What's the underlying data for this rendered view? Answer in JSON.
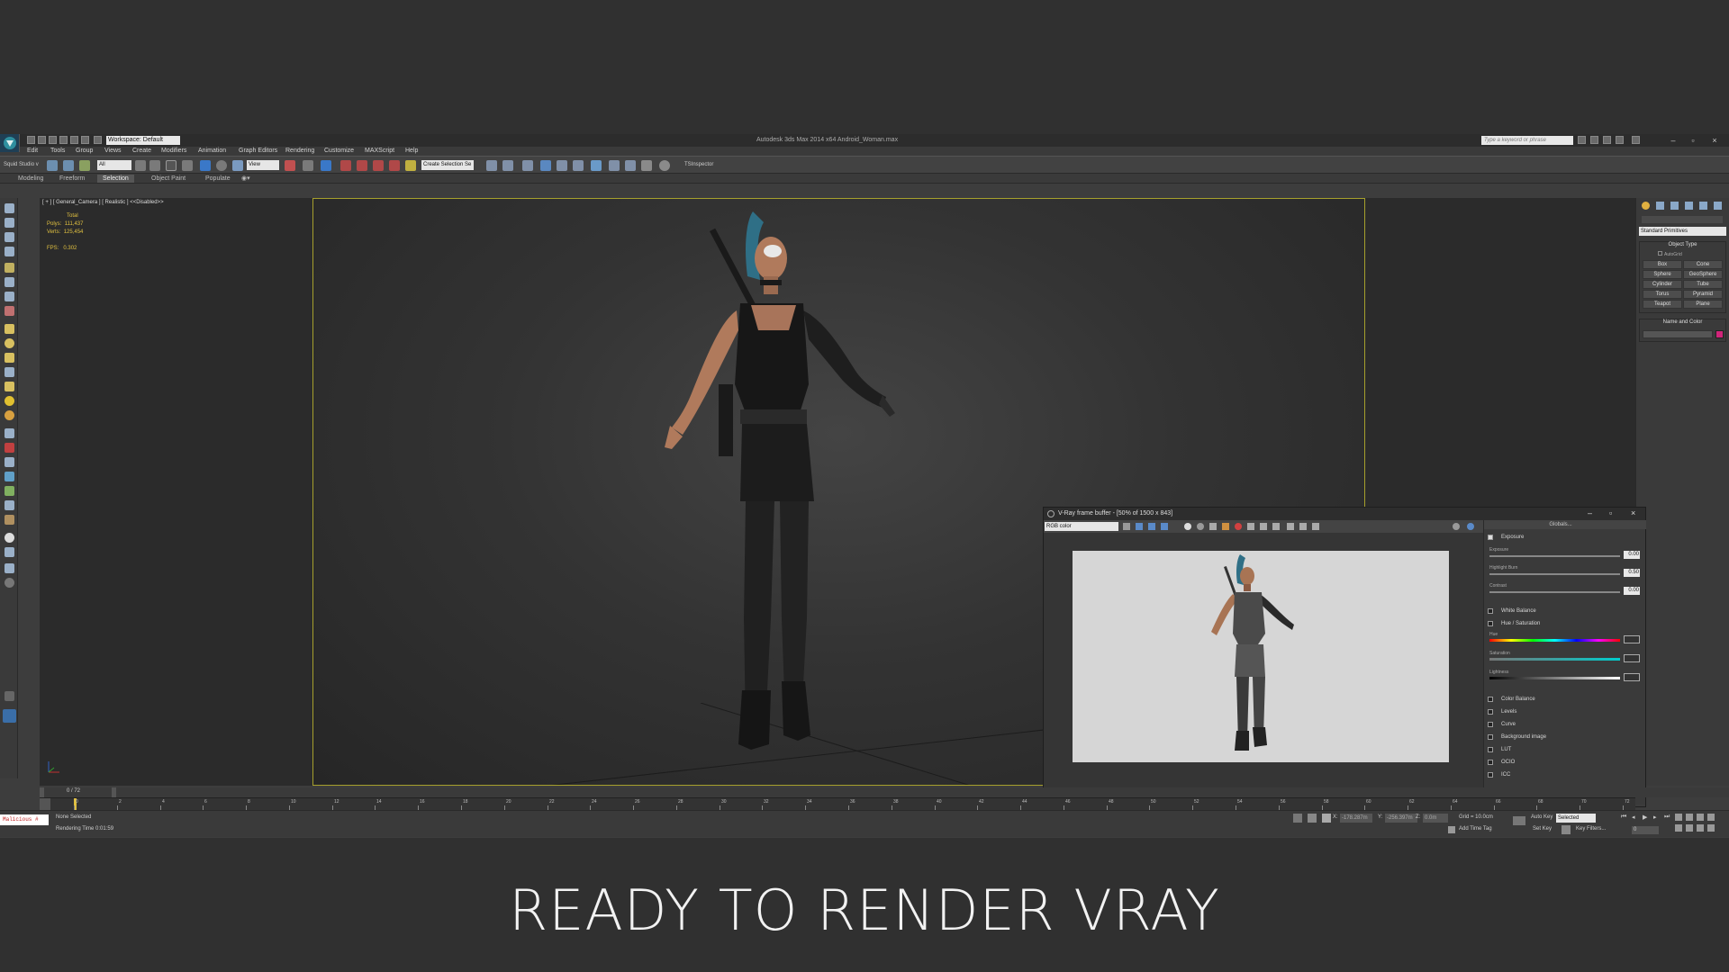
{
  "title_bar": {
    "workspace": "Workspace: Default",
    "title": "Autodesk 3ds Max 2014 x64    Android_Woman.max",
    "search_placeholder": "Type a keyword or phrase"
  },
  "menu": [
    "Edit",
    "Tools",
    "Group",
    "Views",
    "Create",
    "Modifiers",
    "Animation",
    "Graph Editors",
    "Rendering",
    "Customize",
    "MAXScript",
    "Help"
  ],
  "toolbar": {
    "left_label": "Squid Studio v",
    "filter": "All",
    "ref_coord": "View",
    "selection_set": "Create Selection Se",
    "tsinspector": "TSInspector"
  },
  "ribbon": {
    "tabs": [
      "Modeling",
      "Freeform",
      "Selection",
      "Object Paint",
      "Populate"
    ],
    "active": "Selection"
  },
  "viewport": {
    "label": "[ + ] [ General_Camera ] [ Realistic ]  <<Disabled>>",
    "stats": {
      "total_label": "Total",
      "polys_label": "Polys:",
      "polys": "111,437",
      "verts_label": "Verts:",
      "verts": "125,454",
      "fps_label": "FPS:",
      "fps": "0.302"
    }
  },
  "command_panel": {
    "dropdown": "Standard Primitives",
    "object_type_title": "Object Type",
    "autogrid": "AutoGrid",
    "primitives": [
      "Box",
      "Cone",
      "Sphere",
      "GeoSphere",
      "Cylinder",
      "Tube",
      "Torus",
      "Pyramid",
      "Teapot",
      "Plane"
    ],
    "name_color_title": "Name and Color",
    "swatch_color": "#d0257a"
  },
  "vfb": {
    "title": "V-Ray frame buffer - [50% of 1500 x 843]",
    "channel": "RGB color",
    "globals": "Globals...",
    "exposure": {
      "header": "Exposure",
      "exposure_label": "Exposure",
      "exposure_value": "0.00",
      "highlight_label": "Highlight Burn",
      "highlight_value": "0.50",
      "contrast_label": "Contrast",
      "contrast_value": "0.00"
    },
    "white_balance": "White Balance",
    "hue_saturation": "Hue / Saturation",
    "hue_label": "Hue",
    "saturation_label": "Saturation",
    "lightness_label": "Lightness",
    "sections": [
      "Color Balance",
      "Levels",
      "Curve",
      "Background image",
      "LUT",
      "OCIO",
      "ICC"
    ]
  },
  "timeline": {
    "frame": "0 / 72",
    "ticks": [
      "0",
      "2",
      "4",
      "6",
      "8",
      "10",
      "12",
      "14",
      "16",
      "18",
      "20",
      "22",
      "24",
      "26",
      "28",
      "30",
      "32",
      "34",
      "36",
      "38",
      "40",
      "42",
      "44",
      "46",
      "48",
      "50",
      "52",
      "54",
      "56",
      "58",
      "60",
      "62",
      "64",
      "66",
      "68",
      "70",
      "72"
    ]
  },
  "status": {
    "maxscript": "Malicious #",
    "selection": "None Selected",
    "render_time": "Rendering Time  0:01:59",
    "x_label": "X:",
    "y_label": "Y:",
    "z_label": "Z:",
    "x": "-178.287m",
    "y": "-256.397m",
    "z": "0.0m",
    "grid": "Grid = 10.0cm",
    "add_time_tag": "Add Time Tag",
    "auto_key": "Auto Key",
    "auto_key_mode": "Selected",
    "set_key": "Set Key",
    "key_filters": "Key Filters...",
    "frame_field": "0"
  },
  "caption": "READY TO RENDER VRAY"
}
